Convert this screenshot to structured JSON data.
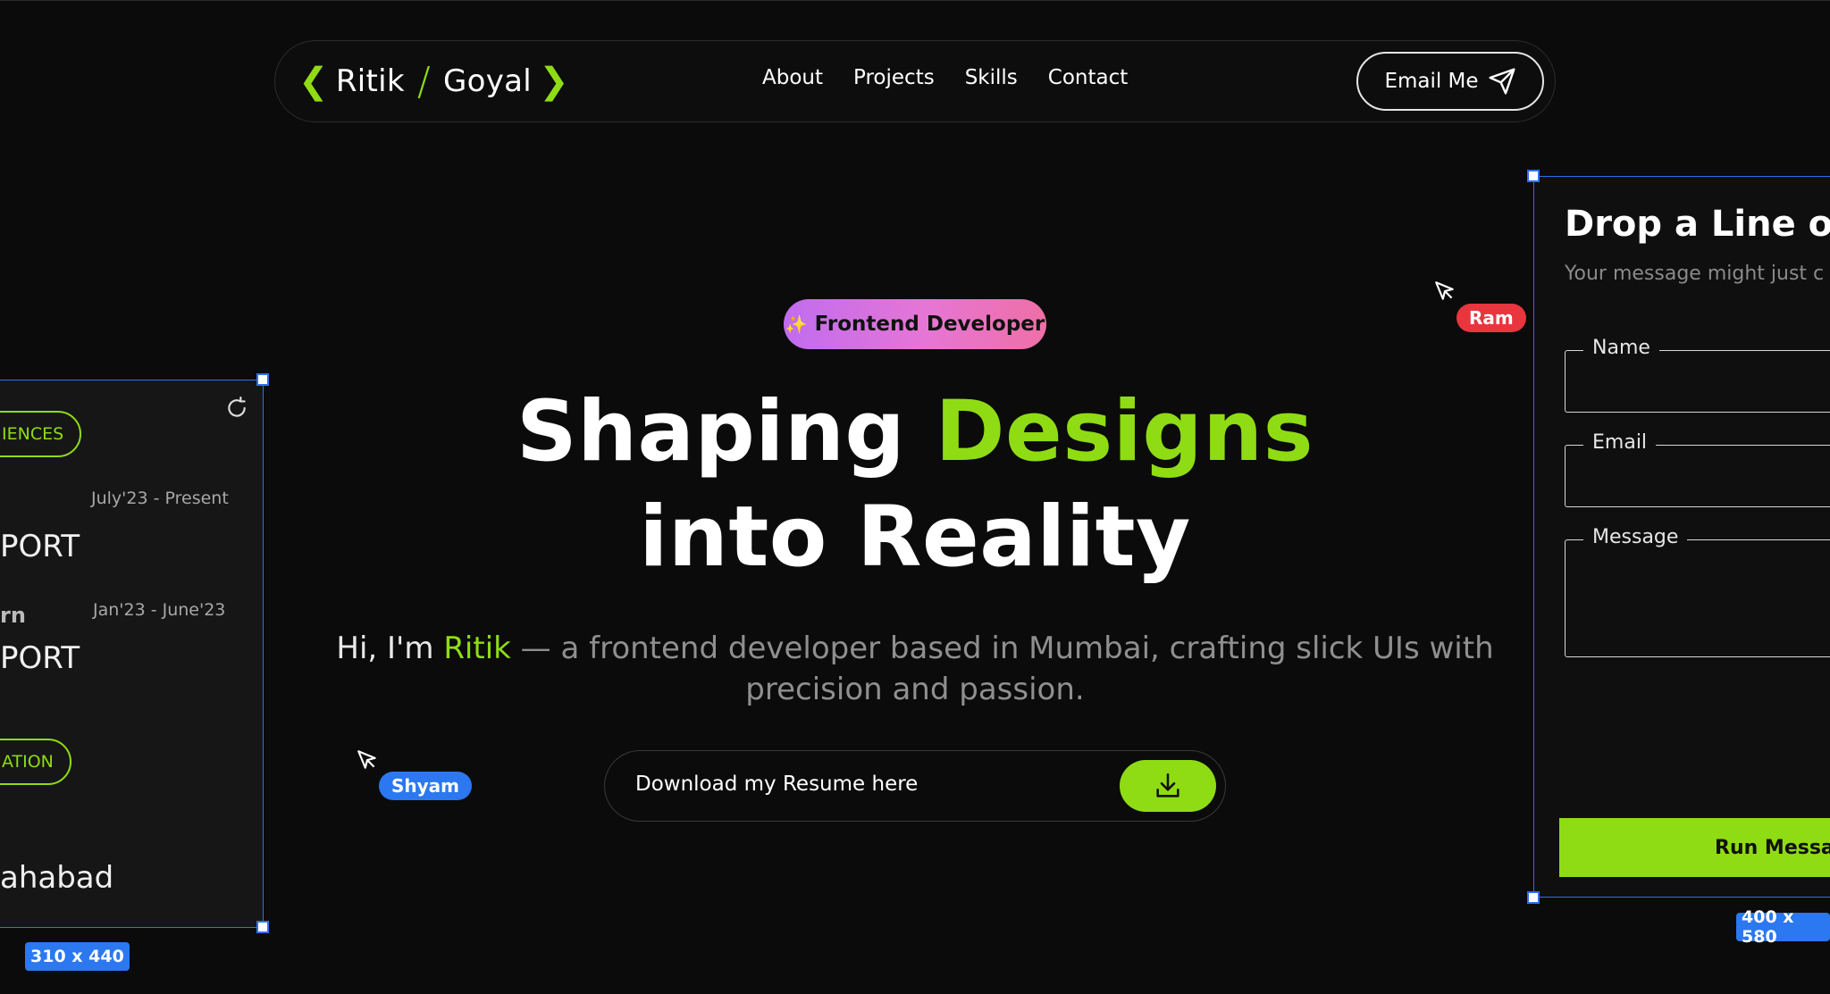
{
  "nav": {
    "logo_first": "Ritik",
    "logo_slash": "/",
    "logo_last": "Goyal",
    "links": [
      "About",
      "Projects",
      "Skills",
      "Contact"
    ],
    "email_label": "Email Me"
  },
  "hero": {
    "badge": "Frontend Developer",
    "headline_1": "Shaping",
    "headline_accent": "Designs",
    "headline_2": "into Reality",
    "sub_hi": "Hi, I'm",
    "sub_name": "Ritik",
    "sub_rest": "— a frontend developer based in Mumbai, crafting slick UIs with precision and passion.",
    "resume_label": "Download my Resume here"
  },
  "cursors": {
    "shyam": "Shyam",
    "ram": "Ram"
  },
  "left_card": {
    "pill_top": "IENCES",
    "date_1": "July'23 - Present",
    "title_1": "PORT",
    "role_2": "rn",
    "date_2": "Jan'23 - June'23",
    "title_2": "PORT",
    "pill_bottom": "ATION",
    "location": "ahabad",
    "size": "310 x 440"
  },
  "right_card": {
    "title": "Drop a Line of",
    "subtitle": "Your message might just c",
    "fields": [
      "Name",
      "Email",
      "Message"
    ],
    "button": "Run Messag",
    "size": "400 x 580"
  },
  "colors": {
    "accent": "#8fdc14",
    "selection": "#2f6ff0",
    "ram_tag": "#e8353e",
    "shyam_tag": "#2b78f0"
  }
}
